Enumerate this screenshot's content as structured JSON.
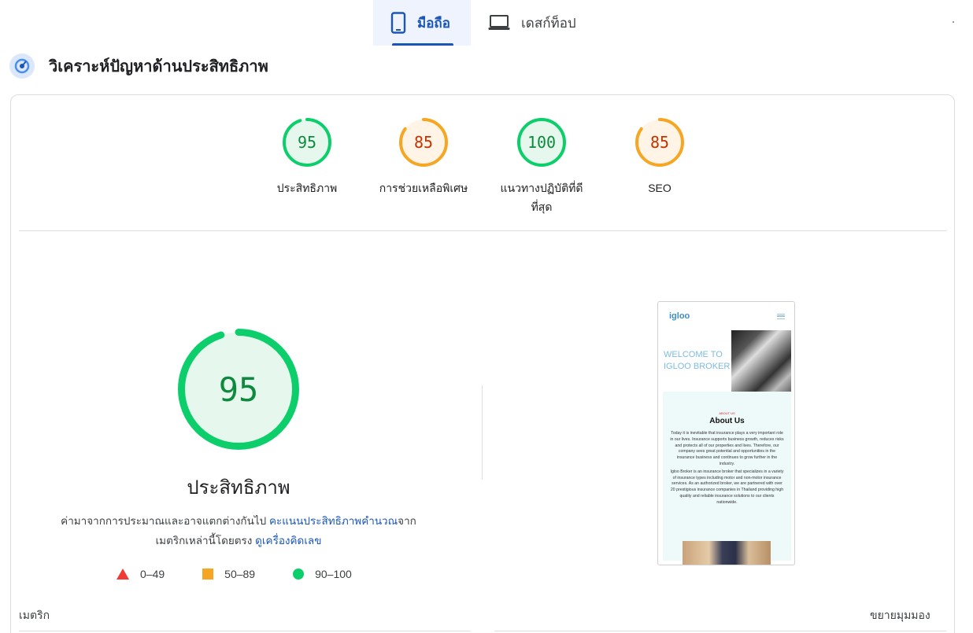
{
  "tabs": {
    "mobile_label": "มือถือ",
    "desktop_label": "เดสก์ท็อป"
  },
  "section": {
    "title": "วิเคราะห์ปัญหาด้านประสิทธิภาพ"
  },
  "scores": [
    {
      "label": "ประสิทธิภาพ",
      "value": "95",
      "status": "pass"
    },
    {
      "label": "การช่วยเหลือพิเศษ",
      "value": "85",
      "status": "average"
    },
    {
      "label": "แนวทางปฏิบัติที่ดี",
      "label2": "ที่สุด",
      "value": "100",
      "status": "pass"
    },
    {
      "label": "SEO",
      "value": "85",
      "status": "average"
    }
  ],
  "performance": {
    "score": "95",
    "title": "ประสิทธิภาพ",
    "desc_prefix": "ค่ามาจากการประมาณและอาจแตกต่างกันไป ",
    "desc_link1": "คะแนนประสิทธิภาพคำนวณ",
    "desc_middle": "จาก",
    "desc_line2_prefix": "เมตริกเหล่านี้โดยตรง ",
    "desc_link2": "ดูเครื่องคิดเลข"
  },
  "legend": {
    "fail": "0–49",
    "average": "50–89",
    "pass": "90–100"
  },
  "metrics": {
    "label": "เมตริก",
    "expand": "ขยายมุมมอง"
  },
  "screenshot": {
    "logo": "igloo",
    "hero_text": "WELCOME TO IGLOO BROKER",
    "about_small": "ABOUT US",
    "about_title": "About Us",
    "about_p1": "Today it is inevitable that insurance plays a very important role in our lives. Insurance supports business growth, reduces risks and protects all of our properties and lives. Therefore, our company sees great potential and opportunities in the insurance business and continues to grow further in the industry.",
    "about_p2": "Igloo Broker is an insurance broker that specializes in a variety of insurance types including motor and non-motor insurance services. As an authorized broker, we are partnered with over 20 prestigious insurance companies in Thailand providing high quality and reliable insurance solutions to our clients nationwide."
  },
  "colors": {
    "pass": "#0cce6b",
    "pass_text": "#0d8a3e",
    "pass_bg": "#e6f8ed",
    "average": "#f5a623",
    "average_text": "#c33300",
    "average_bg": "#fff4e6",
    "fail": "#ef3b33",
    "accent": "#1a56b8"
  },
  "score_fractions": [
    0.95,
    0.85,
    1.0,
    0.85
  ],
  "performance_fraction": 0.95
}
